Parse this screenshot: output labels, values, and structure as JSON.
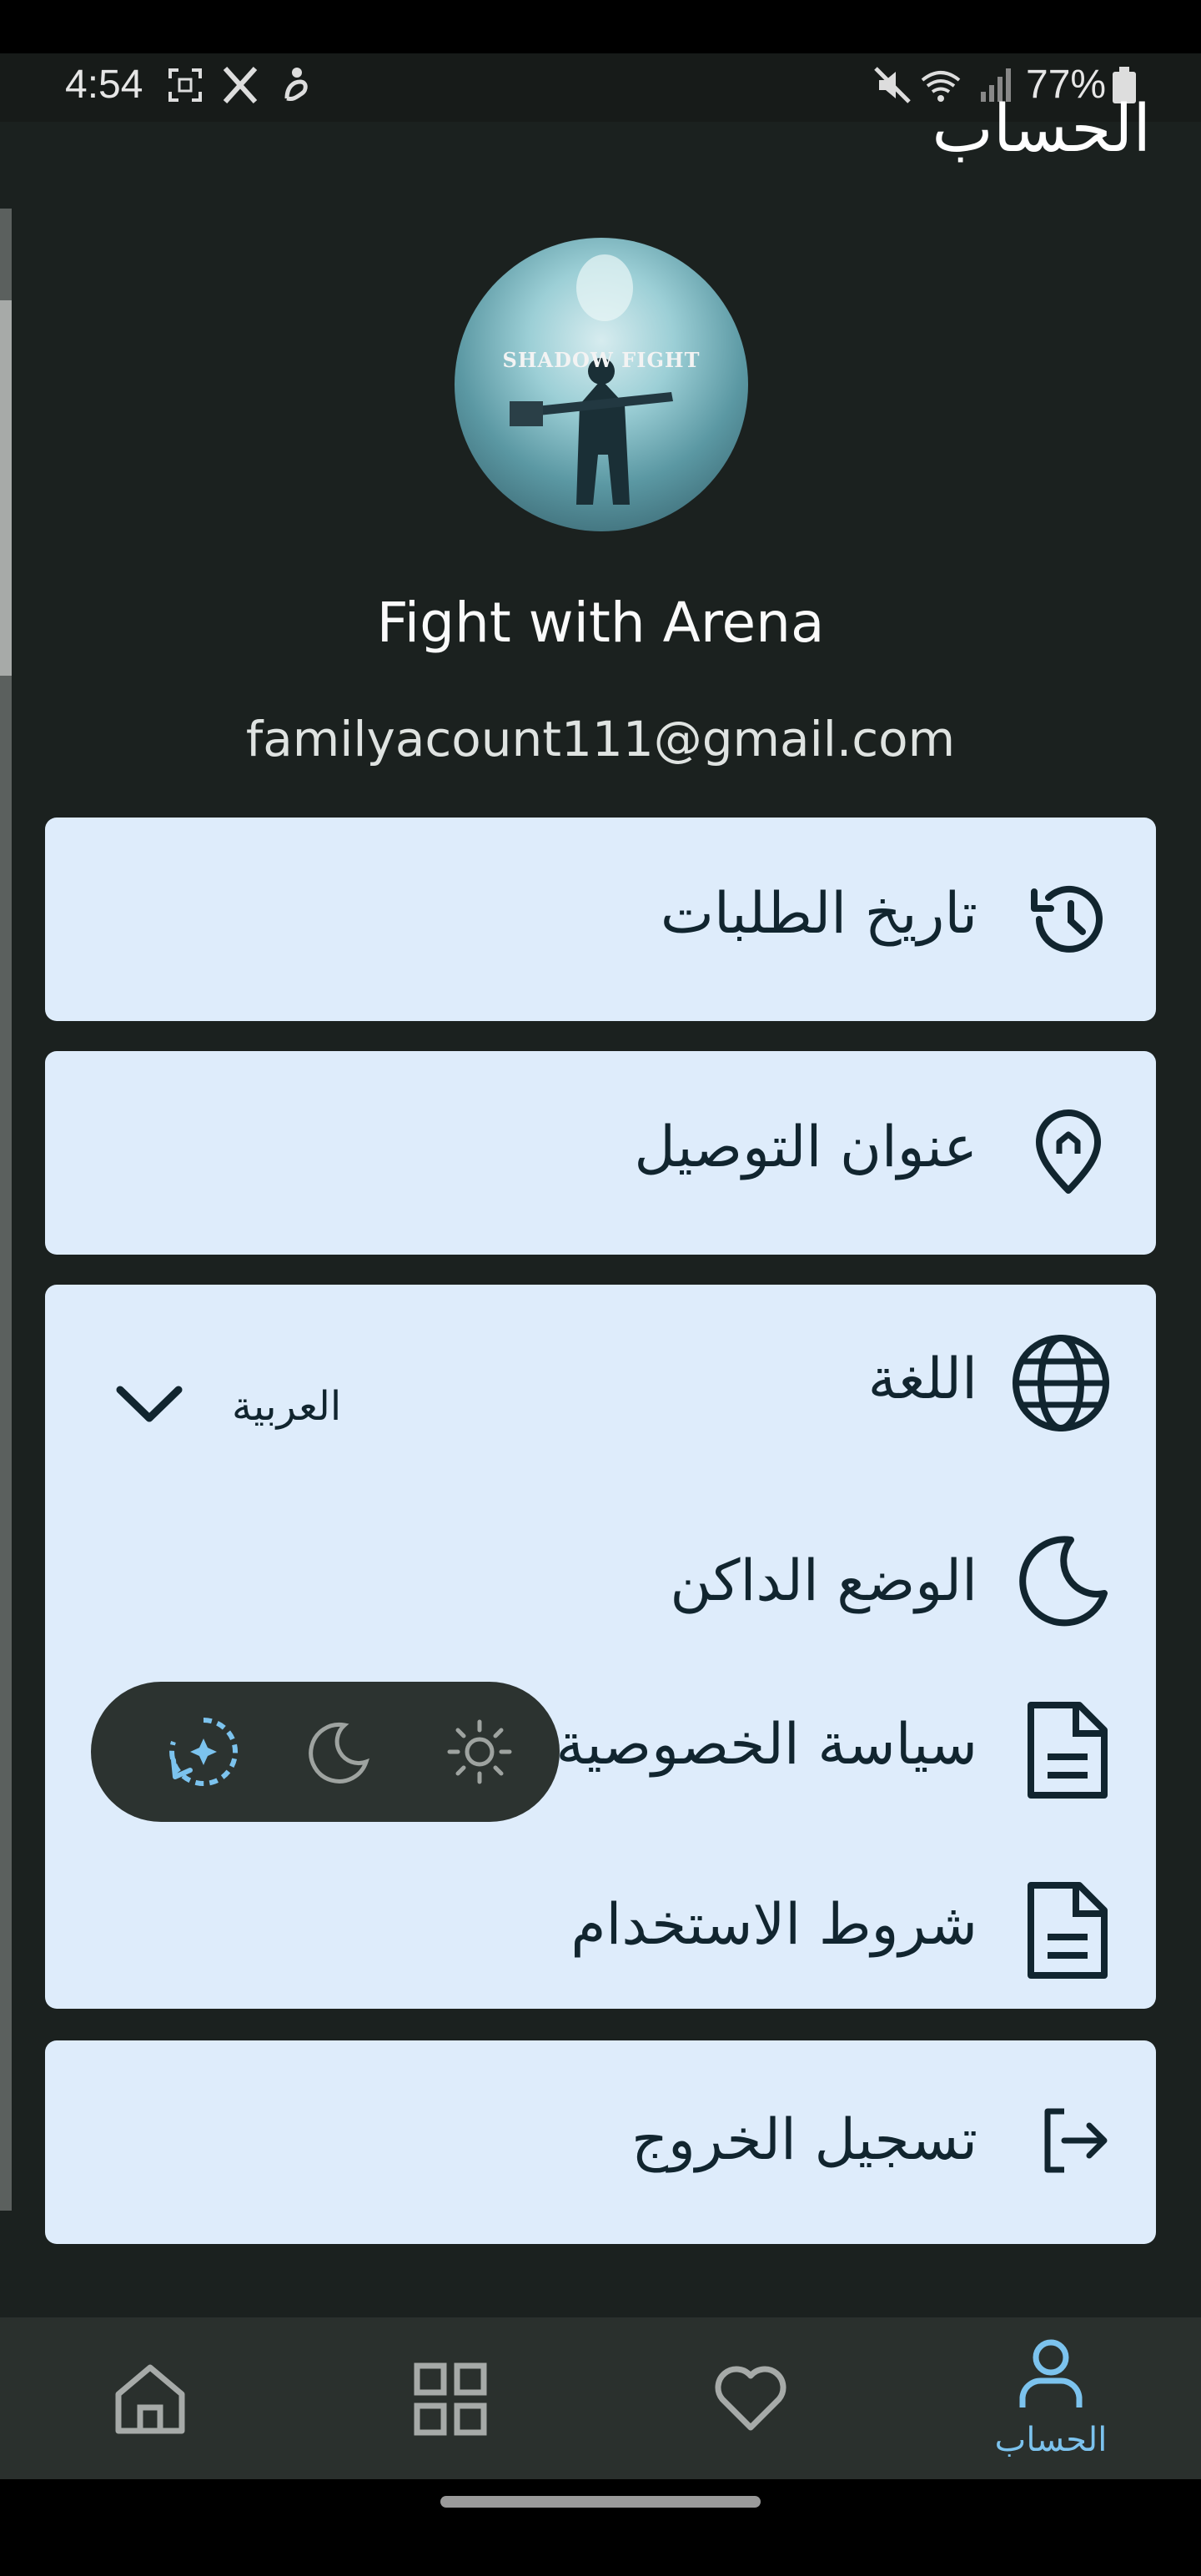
{
  "status_bar": {
    "time": "4:54",
    "battery": "77%",
    "left_icons": [
      "screenshot-icon",
      "x-logo-icon",
      "accessibility-icon"
    ],
    "right_icons": [
      "mute-icon",
      "wifi-icon",
      "signal-icon",
      "battery-icon"
    ]
  },
  "page": {
    "title": "الحساب"
  },
  "profile": {
    "avatar_text": "SHADOW FIGHT",
    "name": "Fight with Arena",
    "email": "familyacount111@gmail.com"
  },
  "menu": {
    "order_history": "تاريخ الطلبات",
    "delivery_address": "عنوان التوصيل",
    "language": {
      "label": "اللغة",
      "value": "العربية"
    },
    "dark_mode": {
      "label": "الوضع الداكن",
      "options": [
        "sun-icon",
        "moon-icon",
        "auto-theme-icon"
      ],
      "selected": "auto-theme-icon"
    },
    "privacy_policy": "سياسة الخصوصية",
    "terms_of_use": "شروط الاستخدام",
    "logout": "تسجيل الخروج"
  },
  "bottom_nav": {
    "items": [
      "home-icon",
      "categories-icon",
      "favorites-icon",
      "account-icon"
    ],
    "active_label": "الحساب"
  },
  "colors": {
    "background": "#1b211f",
    "card": "#deecfb",
    "accent": "#7cc3ee",
    "nav_bg": "#2a302d"
  }
}
